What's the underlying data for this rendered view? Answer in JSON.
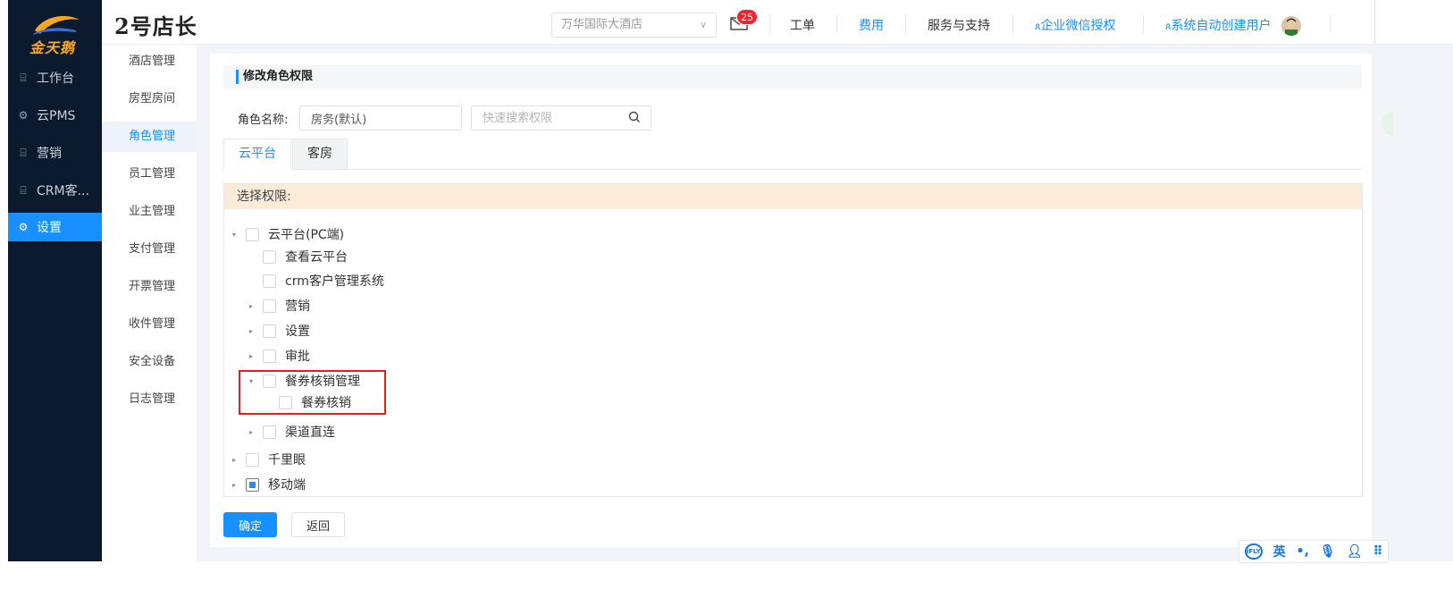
{
  "logo": {
    "text": "金天鹅"
  },
  "brand": "2号店长",
  "left_nav": [
    {
      "label": "工作台",
      "icon": "grid-icon"
    },
    {
      "label": "云PMS",
      "icon": "gear-icon"
    },
    {
      "label": "营销",
      "icon": "grid-icon"
    },
    {
      "label": "CRM客...",
      "icon": "grid-icon"
    },
    {
      "label": "设置",
      "icon": "gear-icon",
      "active": true
    }
  ],
  "sub_nav": [
    {
      "label": "酒店管理"
    },
    {
      "label": "房型房间"
    },
    {
      "label": "角色管理",
      "active": true
    },
    {
      "label": "员工管理"
    },
    {
      "label": "业主管理"
    },
    {
      "label": "支付管理"
    },
    {
      "label": "开票管理"
    },
    {
      "label": "收件管理"
    },
    {
      "label": "安全设备"
    },
    {
      "label": "日志管理"
    }
  ],
  "header": {
    "hotel_select": "万华国际大酒店",
    "mail_badge": "25",
    "links": {
      "work_order": "工单",
      "fee": "费用",
      "support": "服务与支持",
      "wechat_auth": "企业微信授权",
      "user": "系统自动创建用户"
    }
  },
  "panel": {
    "title": "修改角色权限",
    "role_name_label": "角色名称:",
    "role_name_value": "房务(默认)",
    "search_placeholder": "快速搜索权限",
    "tabs": [
      {
        "label": "云平台",
        "active": true
      },
      {
        "label": "客房",
        "active": false
      }
    ],
    "tree_header": "选择权限:",
    "tree": {
      "root_pc": "云平台(PC端)",
      "view_cloud": "查看云平台",
      "crm": "crm客户管理系统",
      "marketing": "营销",
      "settings": "设置",
      "approval": "审批",
      "voucher_mgmt": "餐券核销管理",
      "voucher_writeoff": "餐券核销",
      "channel": "渠道直连",
      "qianliyan": "千里眼",
      "mobile": "移动端"
    },
    "confirm": "确定",
    "back": "返回"
  },
  "ime": {
    "logo": "iFLY",
    "lang": "英"
  },
  "colors": {
    "primary": "#1890ff",
    "nav_bg": "#0b1a2c",
    "tree_header_bg": "#faecd8",
    "highlight": "#e02020"
  }
}
